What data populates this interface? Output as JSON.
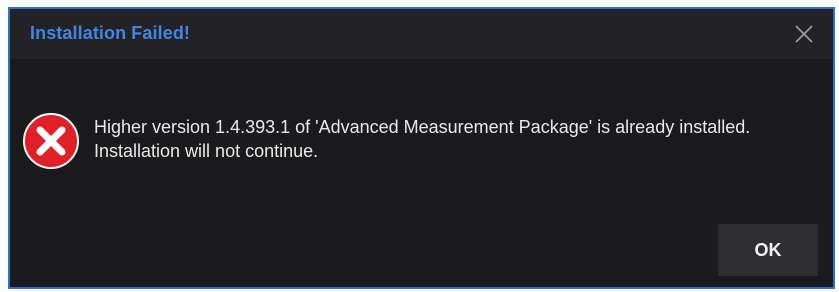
{
  "dialog": {
    "title": "Installation Failed!",
    "message_line1": "Higher version 1.4.393.1 of 'Advanced Measurement Package' is already installed.",
    "message_line2": "Installation will not continue.",
    "ok_label": "OK",
    "icons": {
      "close": "close-icon",
      "error": "error-icon"
    }
  },
  "colors": {
    "background": "#1b1b1d",
    "titlebar": "#232326",
    "title_text": "#3f86e6",
    "border": "#2f6fd0",
    "error_red": "#e01f26",
    "button_bg": "#2e2e32",
    "text": "#e9e9ea"
  }
}
